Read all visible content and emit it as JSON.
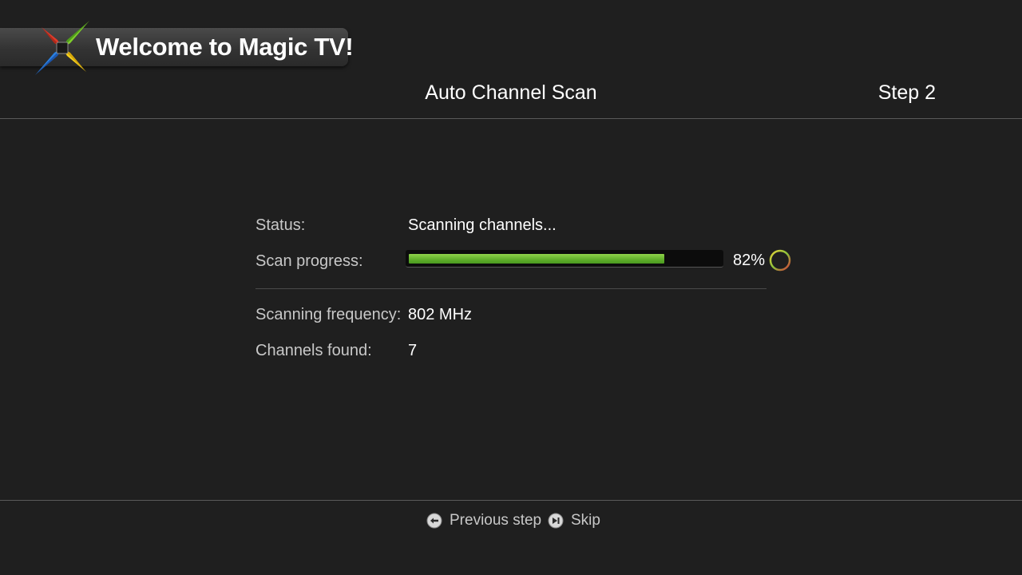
{
  "header": {
    "banner_title": "Welcome to Magic TV!",
    "logo_icon": "magic-tv-logo-icon",
    "page_title": "Auto Channel Scan",
    "step_label": "Step 2"
  },
  "scan": {
    "status_label": "Status:",
    "status_value": "Scanning channels...",
    "progress_label": "Scan progress:",
    "progress_percent": 82,
    "progress_text": "82%",
    "frequency_label": "Scanning frequency:",
    "frequency_value": "802 MHz",
    "channels_label": "Channels found:",
    "channels_value": "7"
  },
  "footer": {
    "previous_label": "Previous step",
    "previous_icon": "arrow-left-icon",
    "skip_label": "Skip",
    "skip_icon": "skip-forward-icon"
  },
  "colors": {
    "background": "#1f1f1f",
    "progress_fill": "#5fae2a",
    "logo_red": "#e03a2a",
    "logo_green": "#6fbf2a",
    "logo_blue": "#1f6fd0",
    "logo_yellow": "#f2c40c"
  }
}
